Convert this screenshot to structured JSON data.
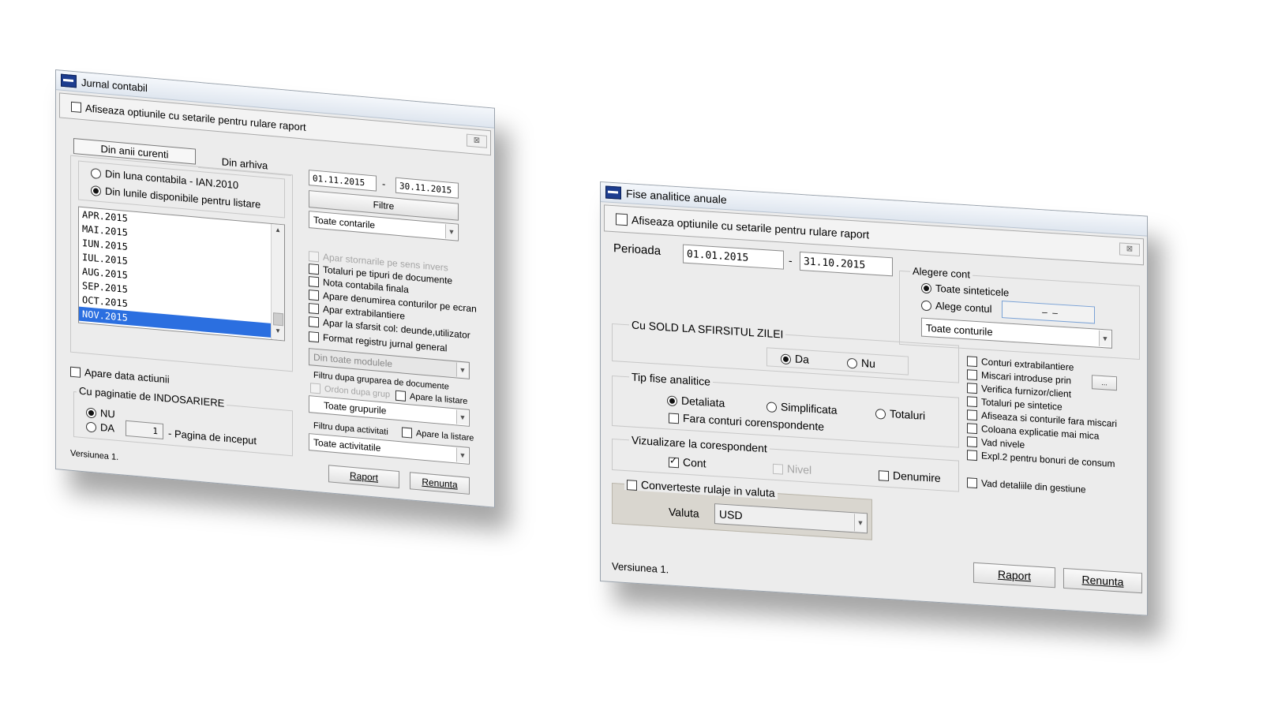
{
  "jurnal": {
    "title": "Jurnal contabil",
    "show_options_label": "Afiseaza optiunile cu setarile pentru rulare raport",
    "close": "⊠",
    "tabs": [
      "Din anii curenti",
      "Din arhiva"
    ],
    "radio_luna": "Din luna contabila - IAN.2010",
    "radio_lunile": "Din lunile disponibile pentru listare",
    "months": [
      "APR.2015",
      "MAI.2015",
      "IUN.2015",
      "IUL.2015",
      "AUG.2015",
      "SEP.2015",
      "OCT.2015",
      "NOV.2015"
    ],
    "selected_month": "NOV.2015",
    "date_from": "01.11.2015",
    "date_to": "30.11.2015",
    "dash": "-",
    "filtre_button": "Filtre",
    "conturi_combo": "Toate contarile",
    "options": {
      "apar_stornarile": "Apar stornarile pe sens invers",
      "totaluri": "Totaluri pe tipuri de documente",
      "nota": "Nota contabila finala",
      "apare_denumirea": "Apare denumirea conturilor pe ecran",
      "apar_extra": "Apar extrabilantiere",
      "apar_sfarsit": "Apar la sfarsit col: deunde,utilizator",
      "format": "Format registru jurnal general"
    },
    "module_combo": "Din toate modulele",
    "filtru_grupare": "Filtru dupa gruparea de documente",
    "ordon_grup": "Ordon dupa grup",
    "apare_listare_1": "Apare la listare",
    "grupuri_combo": "Toate grupurile",
    "filtru_activitati": "Filtru dupa activitati",
    "apare_listare_2": "Apare la listare",
    "activitati_combo": "Toate activitatile",
    "apare_data": "Apare data actiunii",
    "paginatie_title": "Cu paginatie de INDOSARIERE",
    "nu": "NU",
    "da": "DA",
    "pagina_val": "1",
    "pagina_label": "- Pagina de inceput",
    "versiune": "Versiunea 1.",
    "raport": "Raport",
    "renunta": "Renunta"
  },
  "fise": {
    "title": "Fise analitice anuale",
    "show_options_label": "Afiseaza optiunile cu setarile pentru rulare raport",
    "close": "⊠",
    "perioada": "Perioada",
    "date_from": "01.01.2015",
    "date_to": "31.10.2015",
    "dash": "-",
    "alegere_cont": "Alegere cont",
    "toate_sinteticele": "Toate sinteticele",
    "alege_contul": "Alege contul",
    "alege_field": "– –",
    "conturi_combo": "Toate conturile",
    "sold_title": "Cu SOLD LA SFIRSITUL ZILEI",
    "da": "Da",
    "nu": "Nu",
    "tip_title": "Tip fise analitice",
    "detaliata": "Detaliata",
    "simplificata": "Simplificata",
    "totaluri": "Totaluri",
    "fara_conturi": "Fara conturi corenspondente",
    "viz_title": "Vizualizare la corespondent",
    "cont": "Cont",
    "nivel": "Nivel",
    "denumire": "Denumire",
    "converteste": "Converteste rulaje in valuta",
    "valuta_label": "Valuta",
    "valuta_value": "USD",
    "options": {
      "extrabilantiere": "Conturi extrabilantiere",
      "miscari": "Miscari introduse prin",
      "verifica": "Verifica furnizor/client",
      "totaluri_sint": "Totaluri pe sintetice",
      "afiseaza_fara": "Afiseaza si conturile fara miscari",
      "coloana": "Coloana explicatie mai mica",
      "vad_nivele": "Vad nivele",
      "expl2": "Expl.2 pentru bonuri de consum",
      "vad_detaliile": "Vad detaliile din gestiune"
    },
    "ellipsis": "...",
    "versiune": "Versiunea 1.",
    "raport": "Raport",
    "renunta": "Renunta"
  }
}
